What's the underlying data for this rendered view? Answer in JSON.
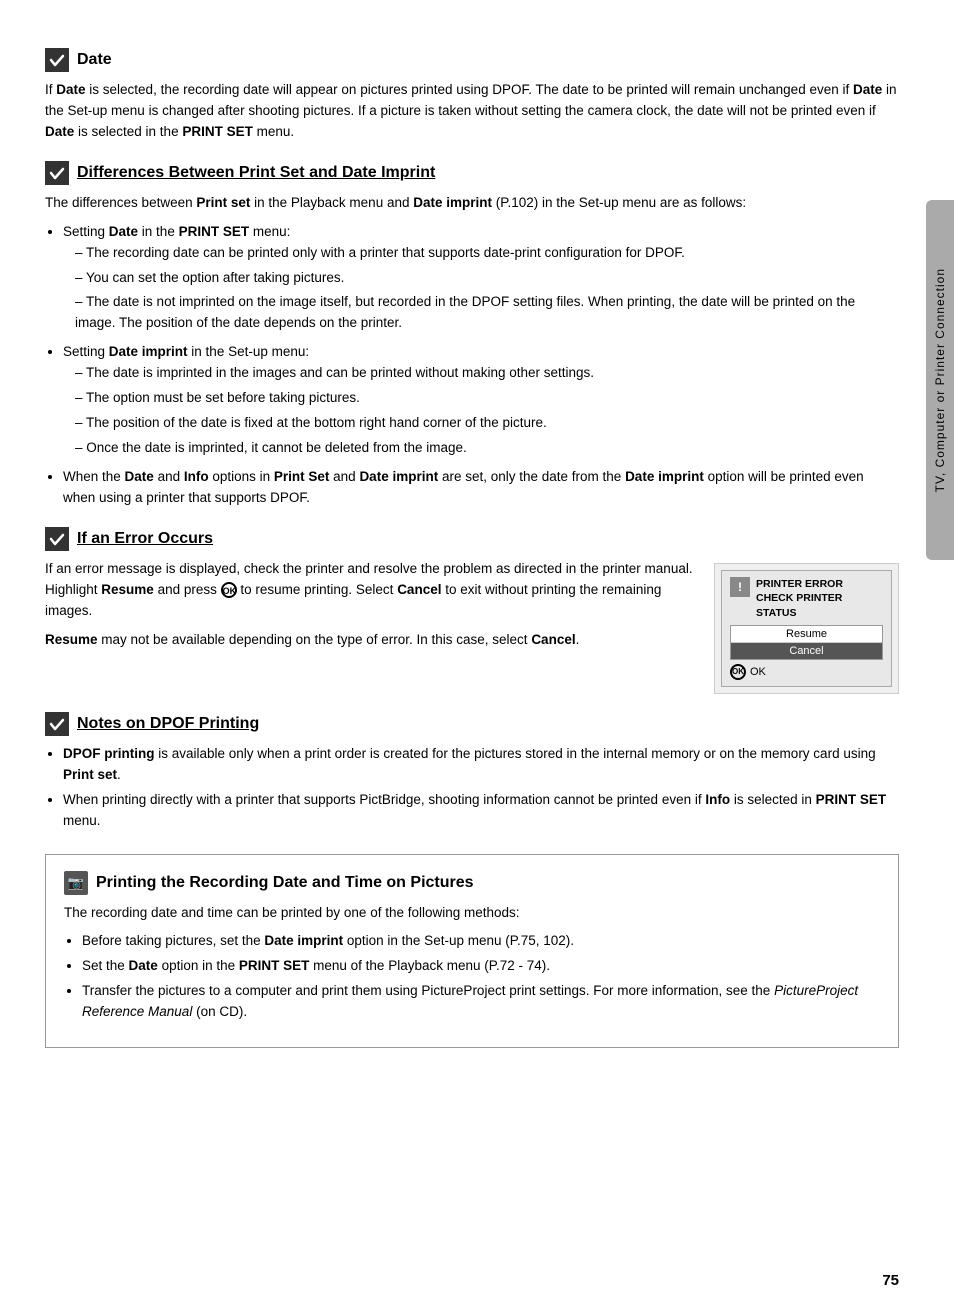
{
  "page": {
    "number": "75",
    "sidebar_label": "TV, Computer or Printer Connection"
  },
  "date_section": {
    "heading": "Date",
    "body": [
      "If <b>Date</b> is selected, the recording date will appear on pictures printed using DPOF. The date to be printed will remain unchanged even if <b>Date</b> in the Set-up menu is changed after shooting pictures. If a picture is taken without setting the camera clock, the date will not be printed even if <b>Date</b> is selected in the <b>PRINT SET</b> menu."
    ]
  },
  "differences_section": {
    "heading": "Differences Between Print Set and Date Imprint",
    "intro": "The differences between <b>Print set</b> in the Playback menu and <b>Date imprint</b> (P.102) in the Set-up menu are as follows:",
    "bullets": [
      {
        "main": "Setting <b>Date</b> in the <b>PRINT SET</b> menu:",
        "sub": [
          "The recording date can be printed only with a printer that supports date-print configuration for DPOF.",
          "You can set the option after taking pictures.",
          "The date is not imprinted on the image itself, but recorded in the DPOF setting files. When printing, the date will be printed on the image. The position of the date depends on the printer."
        ]
      },
      {
        "main": "Setting <b>Date imprint</b> in the Set-up menu:",
        "sub": [
          "The date is imprinted in the images and can be printed without making other settings.",
          "The option must be set before taking pictures.",
          "The position of the date is fixed at the bottom right hand corner of the picture.",
          "Once the date is imprinted, it cannot be deleted from the image."
        ]
      },
      {
        "main": "When the <b>Date</b> and <b>Info</b> options in <b>Print Set</b> and <b>Date imprint</b> are set, only the date from the <b>Date imprint</b> option will be printed even when using a printer that supports DPOF.",
        "sub": []
      }
    ]
  },
  "error_section": {
    "heading": "If an Error Occurs",
    "body1": "If an error message is displayed, check the printer and resolve the problem as directed in the printer manual. Highlight <b>Resume</b> and press <b>OK</b> to resume printing. Select <b>Cancel</b> to exit without printing the remaining images.",
    "body2": "<b>Resume</b> may not be available depending on the type of error. In this case, select <b>Cancel</b>.",
    "printer_dialog": {
      "title_line1": "PRINTER ERROR",
      "title_line2": "CHECK PRINTER",
      "title_line3": "STATUS",
      "btn_resume": "Resume",
      "btn_cancel": "Cancel",
      "ok_label": "OK"
    }
  },
  "notes_dpof_section": {
    "heading": "Notes on DPOF Printing",
    "bullets": [
      "<b>DPOF printing</b> is available only when a print order is created for the pictures stored in the internal memory or on the memory card using <b>Print set</b>.",
      "When printing directly with a printer that supports PictBridge, shooting information cannot be printed even if <b>Info</b> is selected in <b>PRINT SET</b> menu."
    ]
  },
  "printing_box": {
    "heading": "Printing the Recording Date and Time on Pictures",
    "intro": "The recording date and time can be printed by one of the following methods:",
    "bullets": [
      "Before taking pictures, set the <b>Date imprint</b> option in the Set-up menu (P.75, 102).",
      "Set the <b>Date</b> option in the <b>PRINT SET</b> menu of the Playback menu (P.72 - 74).",
      "Transfer the pictures to a computer and print them using PictureProject print settings. For more information, see the <i>PictureProject Reference Manual</i> (on CD)."
    ]
  }
}
